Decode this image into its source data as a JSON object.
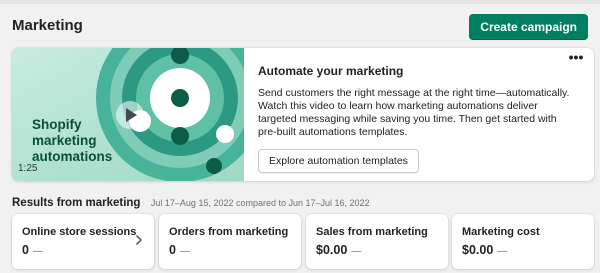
{
  "header": {
    "title": "Marketing",
    "create_button": "Create campaign"
  },
  "promo": {
    "video_title": "Shopify marketing automations",
    "video_duration": "1:25",
    "title": "Automate your marketing",
    "body": "Send customers the right message at the right time—automatically. Watch this video to learn how marketing automations deliver targeted messaging while saving you time. Then get started with pre-built automations templates.",
    "button": "Explore automation templates",
    "more_label": "•••",
    "icons": [
      "play-icon",
      "more-horizontal-icon"
    ],
    "colors": {
      "accent": "#008060",
      "video_bg": "#b8e3d3",
      "video_ring": "#2c9a83",
      "video_text": "#0b4d3a"
    }
  },
  "results": {
    "title": "Results from marketing",
    "range": "Jul 17–Aug 15, 2022 compared to Jun 17–Jul 16, 2022",
    "metrics": [
      {
        "label": "Online store sessions",
        "value": "0",
        "trend": "—",
        "has_chevron": true
      },
      {
        "label": "Orders from marketing",
        "value": "0",
        "trend": "—"
      },
      {
        "label": "Sales from marketing",
        "value": "$0.00",
        "trend": "—"
      },
      {
        "label": "Marketing cost",
        "value": "$0.00",
        "trend": "—"
      }
    ]
  }
}
